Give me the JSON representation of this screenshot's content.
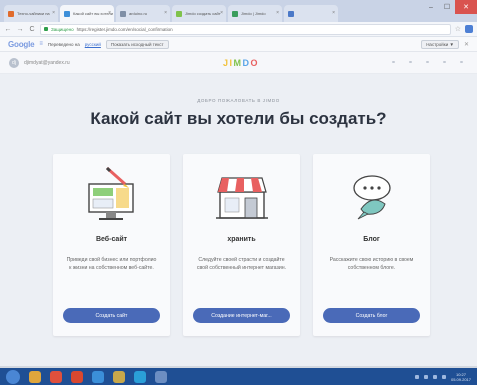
{
  "browser": {
    "tabs": [
      {
        "label": "Техно-чайники на",
        "active": false,
        "color": "#e06b2c"
      },
      {
        "label": "Какой сайт вы хотели",
        "active": true,
        "color": "#3d8fd9"
      },
      {
        "label": "arduino.ru",
        "active": false,
        "color": "#7f8fa6"
      },
      {
        "label": "Jimdo создать сайт",
        "active": false,
        "color": "#7fc24b"
      },
      {
        "label": "Jimdo | Jimdo",
        "active": false,
        "color": "#3a9d5d"
      },
      {
        "label": "",
        "active": false,
        "color": "#4b79c8"
      }
    ],
    "window_controls": {
      "minimize": "–",
      "maximize": "☐",
      "close": "✕"
    },
    "back": "←",
    "forward": "→",
    "reload": "C",
    "secure_label": "Защищено",
    "url": "https://register.jimdo.com/en/social_confirmation",
    "star": "☆"
  },
  "translate": {
    "google": "Google",
    "text": "Переведено на",
    "lang": "русский",
    "show_original": "Показать исходный текст",
    "options": "Настройки ▼",
    "close": "✕"
  },
  "site": {
    "user_initial": "dj",
    "user_email": "djimdyat@yandex.ru",
    "logo": [
      "J",
      "I",
      "M",
      "D",
      "O"
    ],
    "welcome": "ДОБРО ПОЖАЛОВАТЬ В JIMDO",
    "heading": "Какой сайт вы хотели бы создать?",
    "cards": [
      {
        "icon": "website-icon",
        "title": "Веб-сайт",
        "description": "Приведи свой бизнес или портфолио к жизни на собственном веб-сайте.",
        "button": "Создать сайт"
      },
      {
        "icon": "store-icon",
        "title": "хранить",
        "description": "Следуйте своей страсти и создайте свой собственный интернет магазин.",
        "button": "Создание интернет-маг..."
      },
      {
        "icon": "chat-bubble-icon",
        "title": "Блог",
        "description": "Расскажите свою историю в своем собственном блоге.",
        "button": "Создать блог"
      }
    ]
  },
  "taskbar": {
    "apps": [
      "explorer",
      "chrome",
      "yandex",
      "ie",
      "files",
      "skype",
      "window"
    ],
    "time": "10:27",
    "date": "05.09.2017"
  },
  "colors": {
    "accent_button": "#4a6ab8",
    "taskbar": "#1f4f94",
    "background": "#eceff4"
  }
}
